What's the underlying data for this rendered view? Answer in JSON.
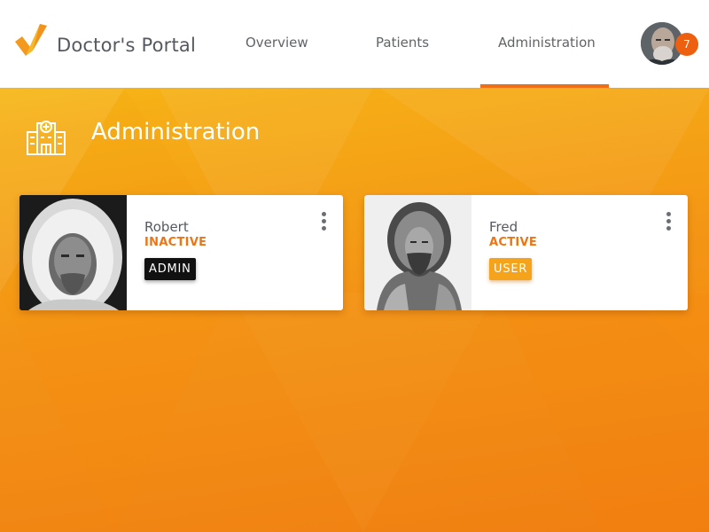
{
  "header": {
    "brand": "Doctor's Portal",
    "nav": [
      {
        "label": "Overview"
      },
      {
        "label": "Patients"
      },
      {
        "label": "Administration",
        "active": true
      }
    ],
    "notification_count": "7"
  },
  "section": {
    "title": "Administration",
    "icon": "hospital-icon"
  },
  "users": [
    {
      "name": "Robert",
      "status": "INACTIVE",
      "role": "ADMIN"
    },
    {
      "name": "Fred",
      "status": "ACTIVE",
      "role": "USER"
    }
  ],
  "colors": {
    "accent": "#ef6f16",
    "status": "#ee7513",
    "admin_badge": "#111111",
    "user_badge": "#f4a31a"
  }
}
